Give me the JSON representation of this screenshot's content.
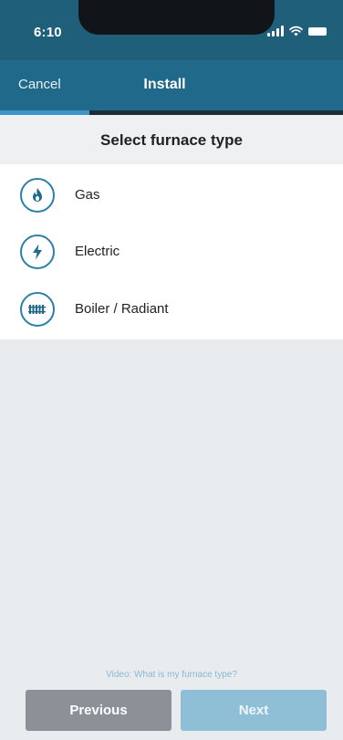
{
  "status_bar": {
    "time": "6:10"
  },
  "header": {
    "cancel_label": "Cancel",
    "title": "Install",
    "progress_fraction": 0.26
  },
  "section": {
    "title": "Select furnace type"
  },
  "options": [
    {
      "label": "Gas",
      "icon": "flame-icon"
    },
    {
      "label": "Electric",
      "icon": "lightning-bolt-icon"
    },
    {
      "label": "Boiler / Radiant",
      "icon": "radiator-icon"
    }
  ],
  "footer": {
    "video_link": "Video: What is my furnace type?",
    "previous_label": "Previous",
    "next_label": "Next"
  },
  "colors": {
    "header": "#20698a",
    "accent": "#2c7fa8",
    "previous_button": "#8b9197",
    "next_button": "#8fbfd7"
  }
}
